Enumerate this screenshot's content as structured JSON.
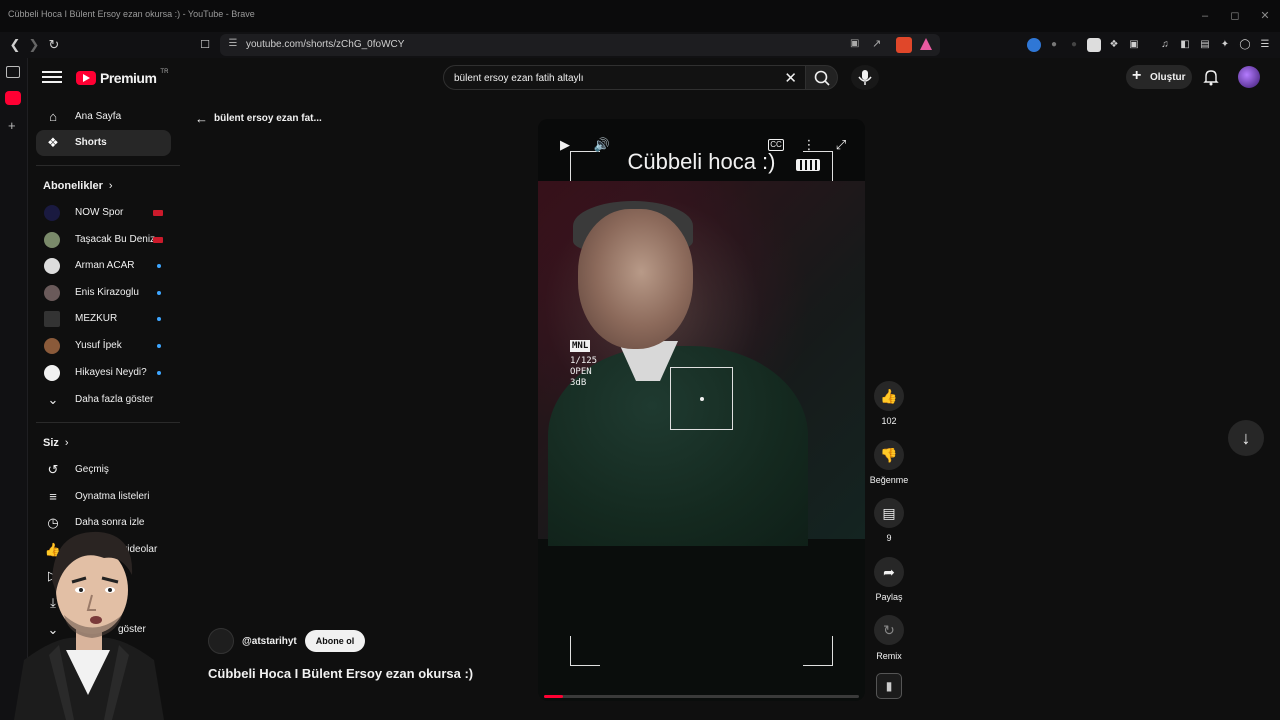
{
  "browser": {
    "window_title": "Cübbeli Hoca I Bülent Ersoy ezan okursa :) - YouTube - Brave",
    "url": "youtube.com/shorts/zChG_0foWCY"
  },
  "youtube": {
    "logo_text": "Premium",
    "logo_sup": "TR",
    "search_query": "bülent ersoy ezan fatih altaylı",
    "create_label": "Oluştur"
  },
  "nav": {
    "home": "Ana Sayfa",
    "shorts": "Shorts",
    "subscriptions_title": "Abonelikler",
    "subscriptions": [
      {
        "label": "NOW Spor",
        "badge": "live"
      },
      {
        "label": "Taşacak Bu Deniz",
        "badge": "live"
      },
      {
        "label": "Arman ACAR",
        "badge": "dot"
      },
      {
        "label": "Enis Kirazoglu",
        "badge": "dot"
      },
      {
        "label": "MEZKUR",
        "badge": "dot"
      },
      {
        "label": "Yusuf İpek",
        "badge": "dot"
      },
      {
        "label": "Hikayesi Neydi?",
        "badge": "dot"
      }
    ],
    "show_more": "Daha fazla göster",
    "you_title": "Siz",
    "you_items": [
      {
        "label": "Geçmiş"
      },
      {
        "label": "Oynatma listeleri"
      },
      {
        "label": "Daha sonra izle"
      },
      {
        "label": "Beğenilen videolar"
      }
    ],
    "show_more_2": "göster"
  },
  "shorts": {
    "back_label": "bülent ersoy ezan fat...",
    "overlay_title": "Cübbeli hoca :)",
    "cam_tag": "MNL",
    "cam_lines": [
      "1/125",
      "OPEN",
      "3dB"
    ],
    "channel": "@atstarihyt",
    "subscribe_label": "Abone ol",
    "video_title": "Cübbeli Hoca I Bülent Ersoy ezan okursa :)",
    "progress": 0.06,
    "actions": {
      "like_count": "102",
      "dislike_label": "Beğenme",
      "comment_count": "9",
      "share_label": "Paylaş",
      "remix_label": "Remix"
    }
  }
}
